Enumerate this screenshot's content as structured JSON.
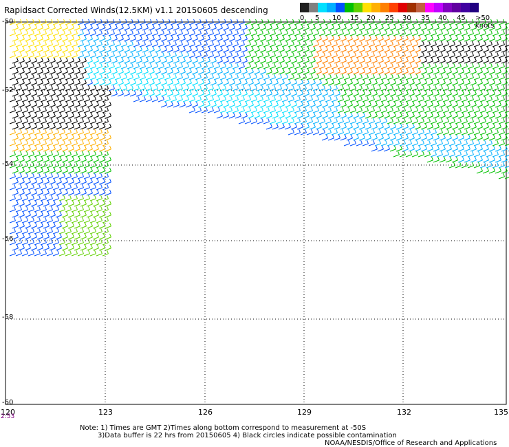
{
  "title": "Rapidsact Corrected Winds(12.5KM) v1.1 20150605 descending",
  "scale": {
    "labels": [
      "0",
      "5",
      "10",
      "15",
      "20",
      "25",
      "30",
      "35",
      "40",
      "45",
      ">50 knots"
    ],
    "colors": [
      "#202020",
      "#808080",
      "#00e0ff",
      "#00b0ff",
      "#0050ff",
      "#00c000",
      "#60d000",
      "#ffe000",
      "#ffb000",
      "#ff8000",
      "#ff4000",
      "#e00000",
      "#a03000",
      "#c06040",
      "#ff00ff",
      "#c000ff",
      "#8000c0",
      "#6000a0",
      "#4000a0",
      "#200080"
    ]
  },
  "map": {
    "lat_labels": [
      "-50",
      "-52",
      "-54",
      "-56",
      "-58",
      "-60"
    ],
    "lon_labels": [
      "120",
      "123",
      "126",
      "129",
      "132",
      "135"
    ],
    "time_label": "2:53"
  },
  "notes": {
    "line1": "Note: 1) Times are GMT 2)Times along bottom correspond to measurement at -50S",
    "line2": "3)Data buffer is 22 hrs from 20150605 4) Black circles indicate possible contamination",
    "line3": "NOAA/NESDIS/Office of Research and Applications"
  }
}
